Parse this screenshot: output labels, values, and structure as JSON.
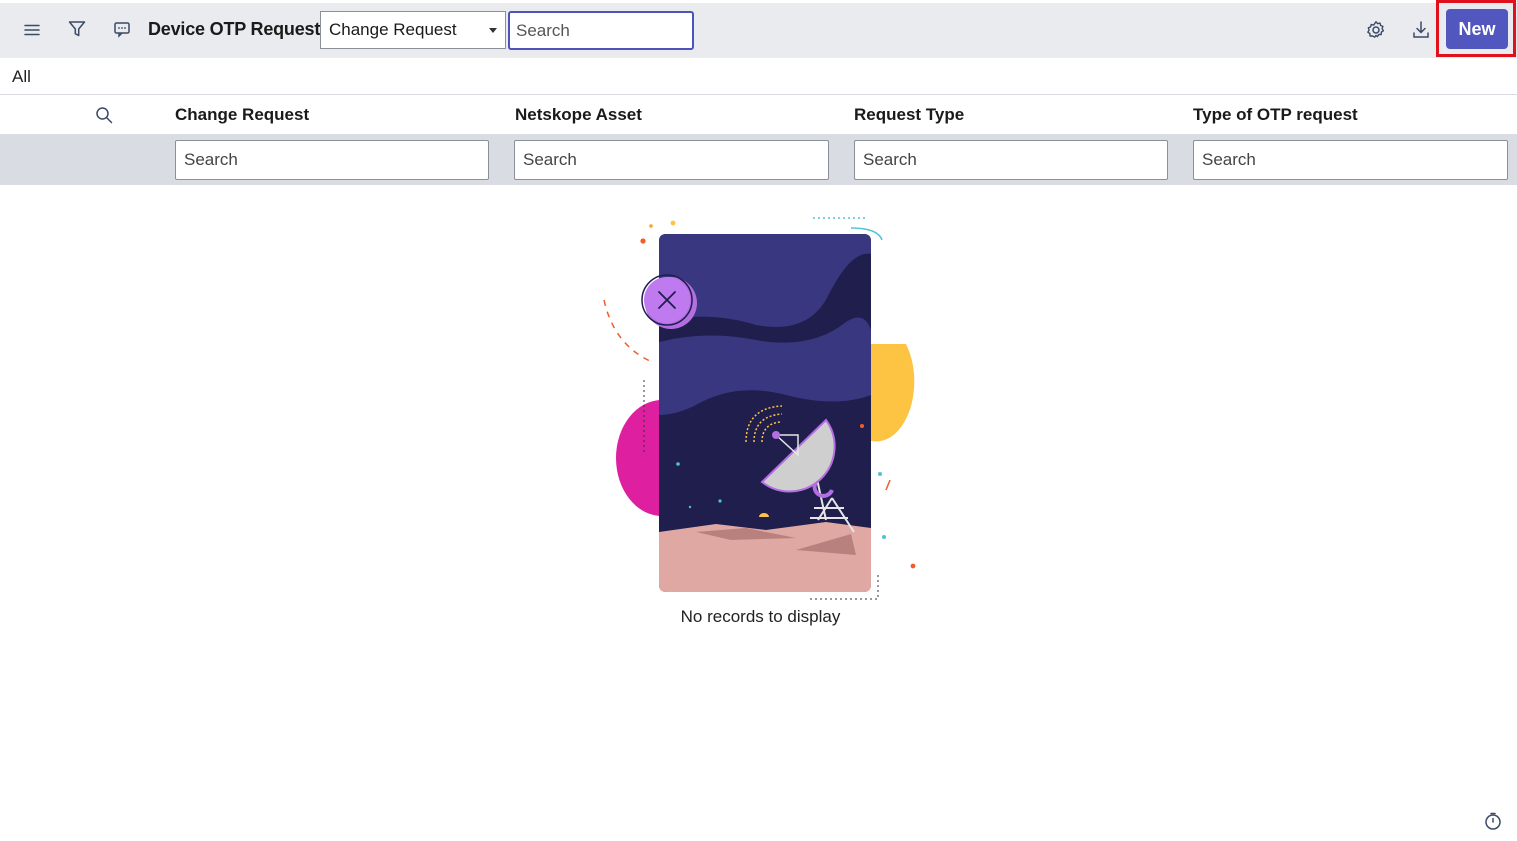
{
  "header": {
    "title": "Device OTP Requests",
    "field_select": {
      "selected": "Change Request"
    },
    "search": {
      "placeholder": "Search"
    },
    "new_button_label": "New",
    "icons": {
      "menu": "hamburger-menu-icon",
      "filter": "filter-funnel-icon",
      "chat": "chat-bubble-icon",
      "settings": "gear-icon",
      "download": "download-icon"
    }
  },
  "breadcrumb": {
    "label": "All"
  },
  "table": {
    "columns": [
      {
        "label": "Change Request",
        "search_placeholder": "Search"
      },
      {
        "label": "Netskope Asset",
        "search_placeholder": "Search"
      },
      {
        "label": "Request Type",
        "search_placeholder": "Search"
      },
      {
        "label": "Type of OTP request",
        "search_placeholder": "Search"
      }
    ]
  },
  "empty_state": {
    "message": "No records to display"
  },
  "colors": {
    "accent": "#5257c0",
    "highlight": "#e0111b",
    "toolbar_bg": "#e9ebef",
    "filter_bg": "#d9dce2"
  }
}
